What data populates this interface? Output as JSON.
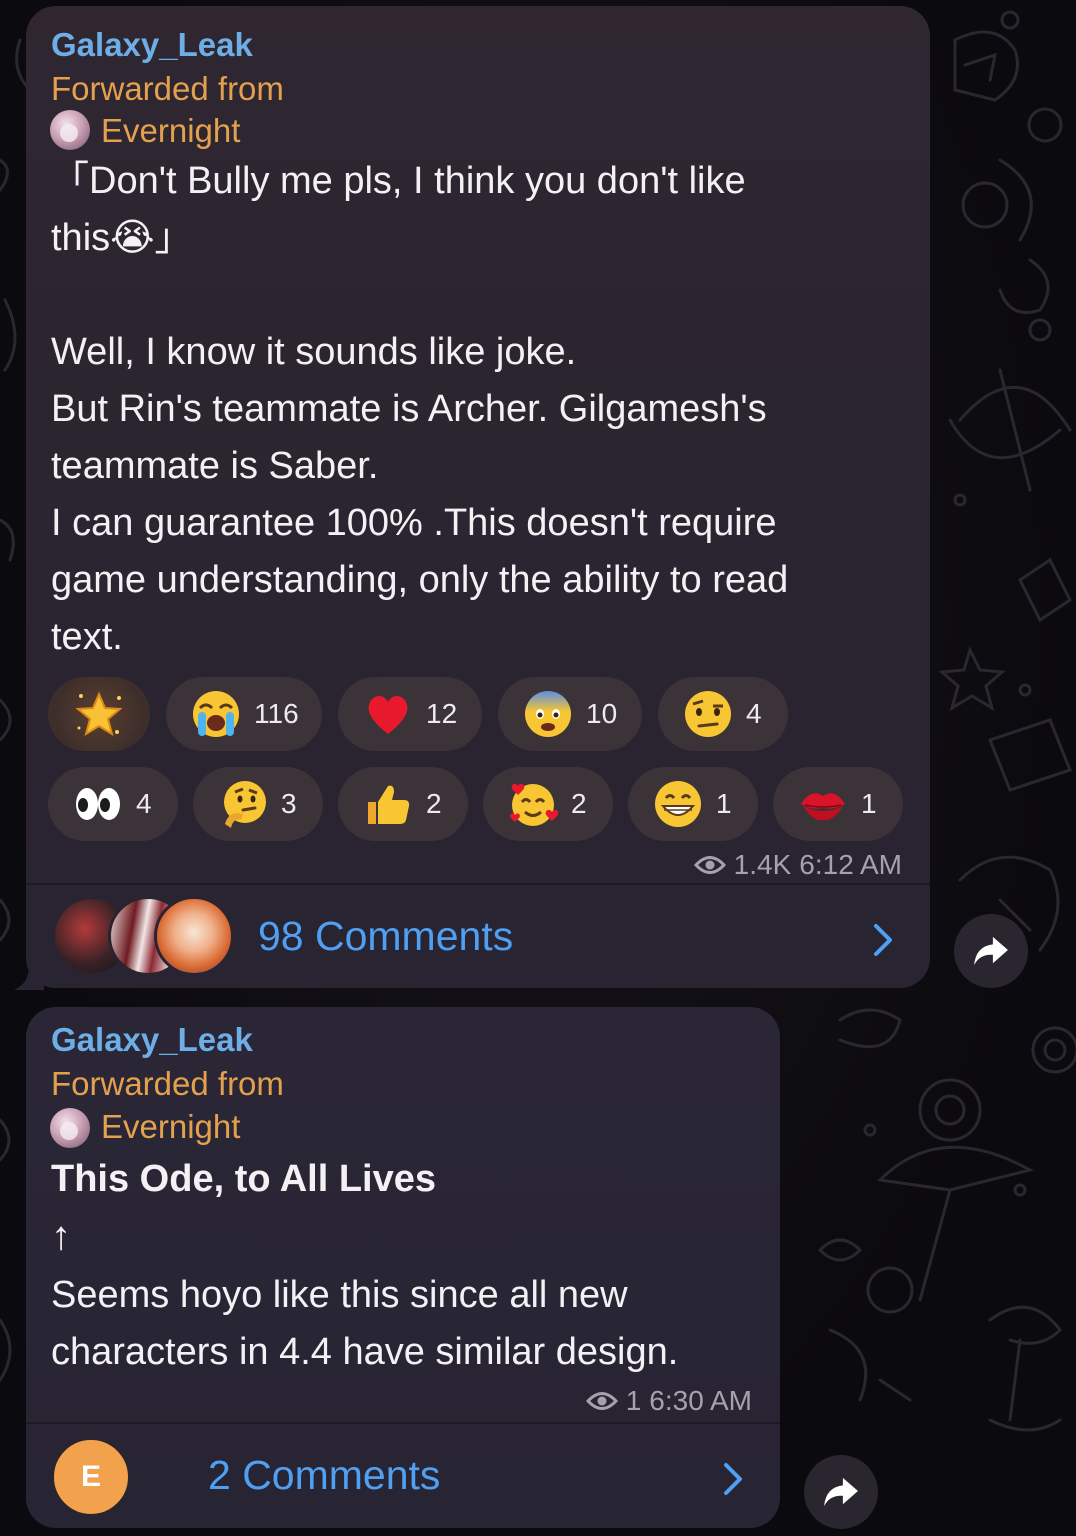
{
  "messages": [
    {
      "sender": "Galaxy_Leak",
      "forwarded_label": "Forwarded from",
      "forwarded_name": "Evernight",
      "text": "「Don't Bully me pls, I think you don't like\nthis😭」\n\nWell, I know it sounds like joke.\nBut Rin's teammate is Archer. Gilgamesh's\nteammate is Saber.\nI can guarantee 100% .This doesn't require\ngame understanding, only the ability to read\ntext.",
      "reactions": [
        {
          "icon": "star-sparkle-icon",
          "count": ""
        },
        {
          "icon": "loudly-crying-face-icon",
          "count": "116"
        },
        {
          "icon": "red-heart-icon",
          "count": "12"
        },
        {
          "icon": "fearful-face-icon",
          "count": "10"
        },
        {
          "icon": "raised-eyebrow-face-icon",
          "count": "4"
        },
        {
          "icon": "eyes-icon",
          "count": "4"
        },
        {
          "icon": "thinking-face-icon",
          "count": "3"
        },
        {
          "icon": "thumbs-up-icon",
          "count": "2"
        },
        {
          "icon": "smiling-face-with-hearts-icon",
          "count": "2"
        },
        {
          "icon": "grinning-face-icon",
          "count": "1"
        },
        {
          "icon": "kiss-mark-icon",
          "count": "1"
        }
      ],
      "views": "1.4K",
      "time": "6:12 AM",
      "comments_label": "98 Comments"
    },
    {
      "sender": "Galaxy_Leak",
      "forwarded_label": "Forwarded from",
      "forwarded_name": "Evernight",
      "title": "This Ode, to All Lives",
      "arrow": "↑",
      "text": "Seems hoyo like this since all new\ncharacters in 4.4 have similar design.",
      "views": "1",
      "time": "6:30 AM",
      "comments_label": "2 Comments",
      "commenter_initial": "E"
    }
  ],
  "colors": {
    "sender": "#6eaee7",
    "forwarded": "#e3a04f",
    "link": "#4f9ff2",
    "meta": "#a7a1ab"
  }
}
